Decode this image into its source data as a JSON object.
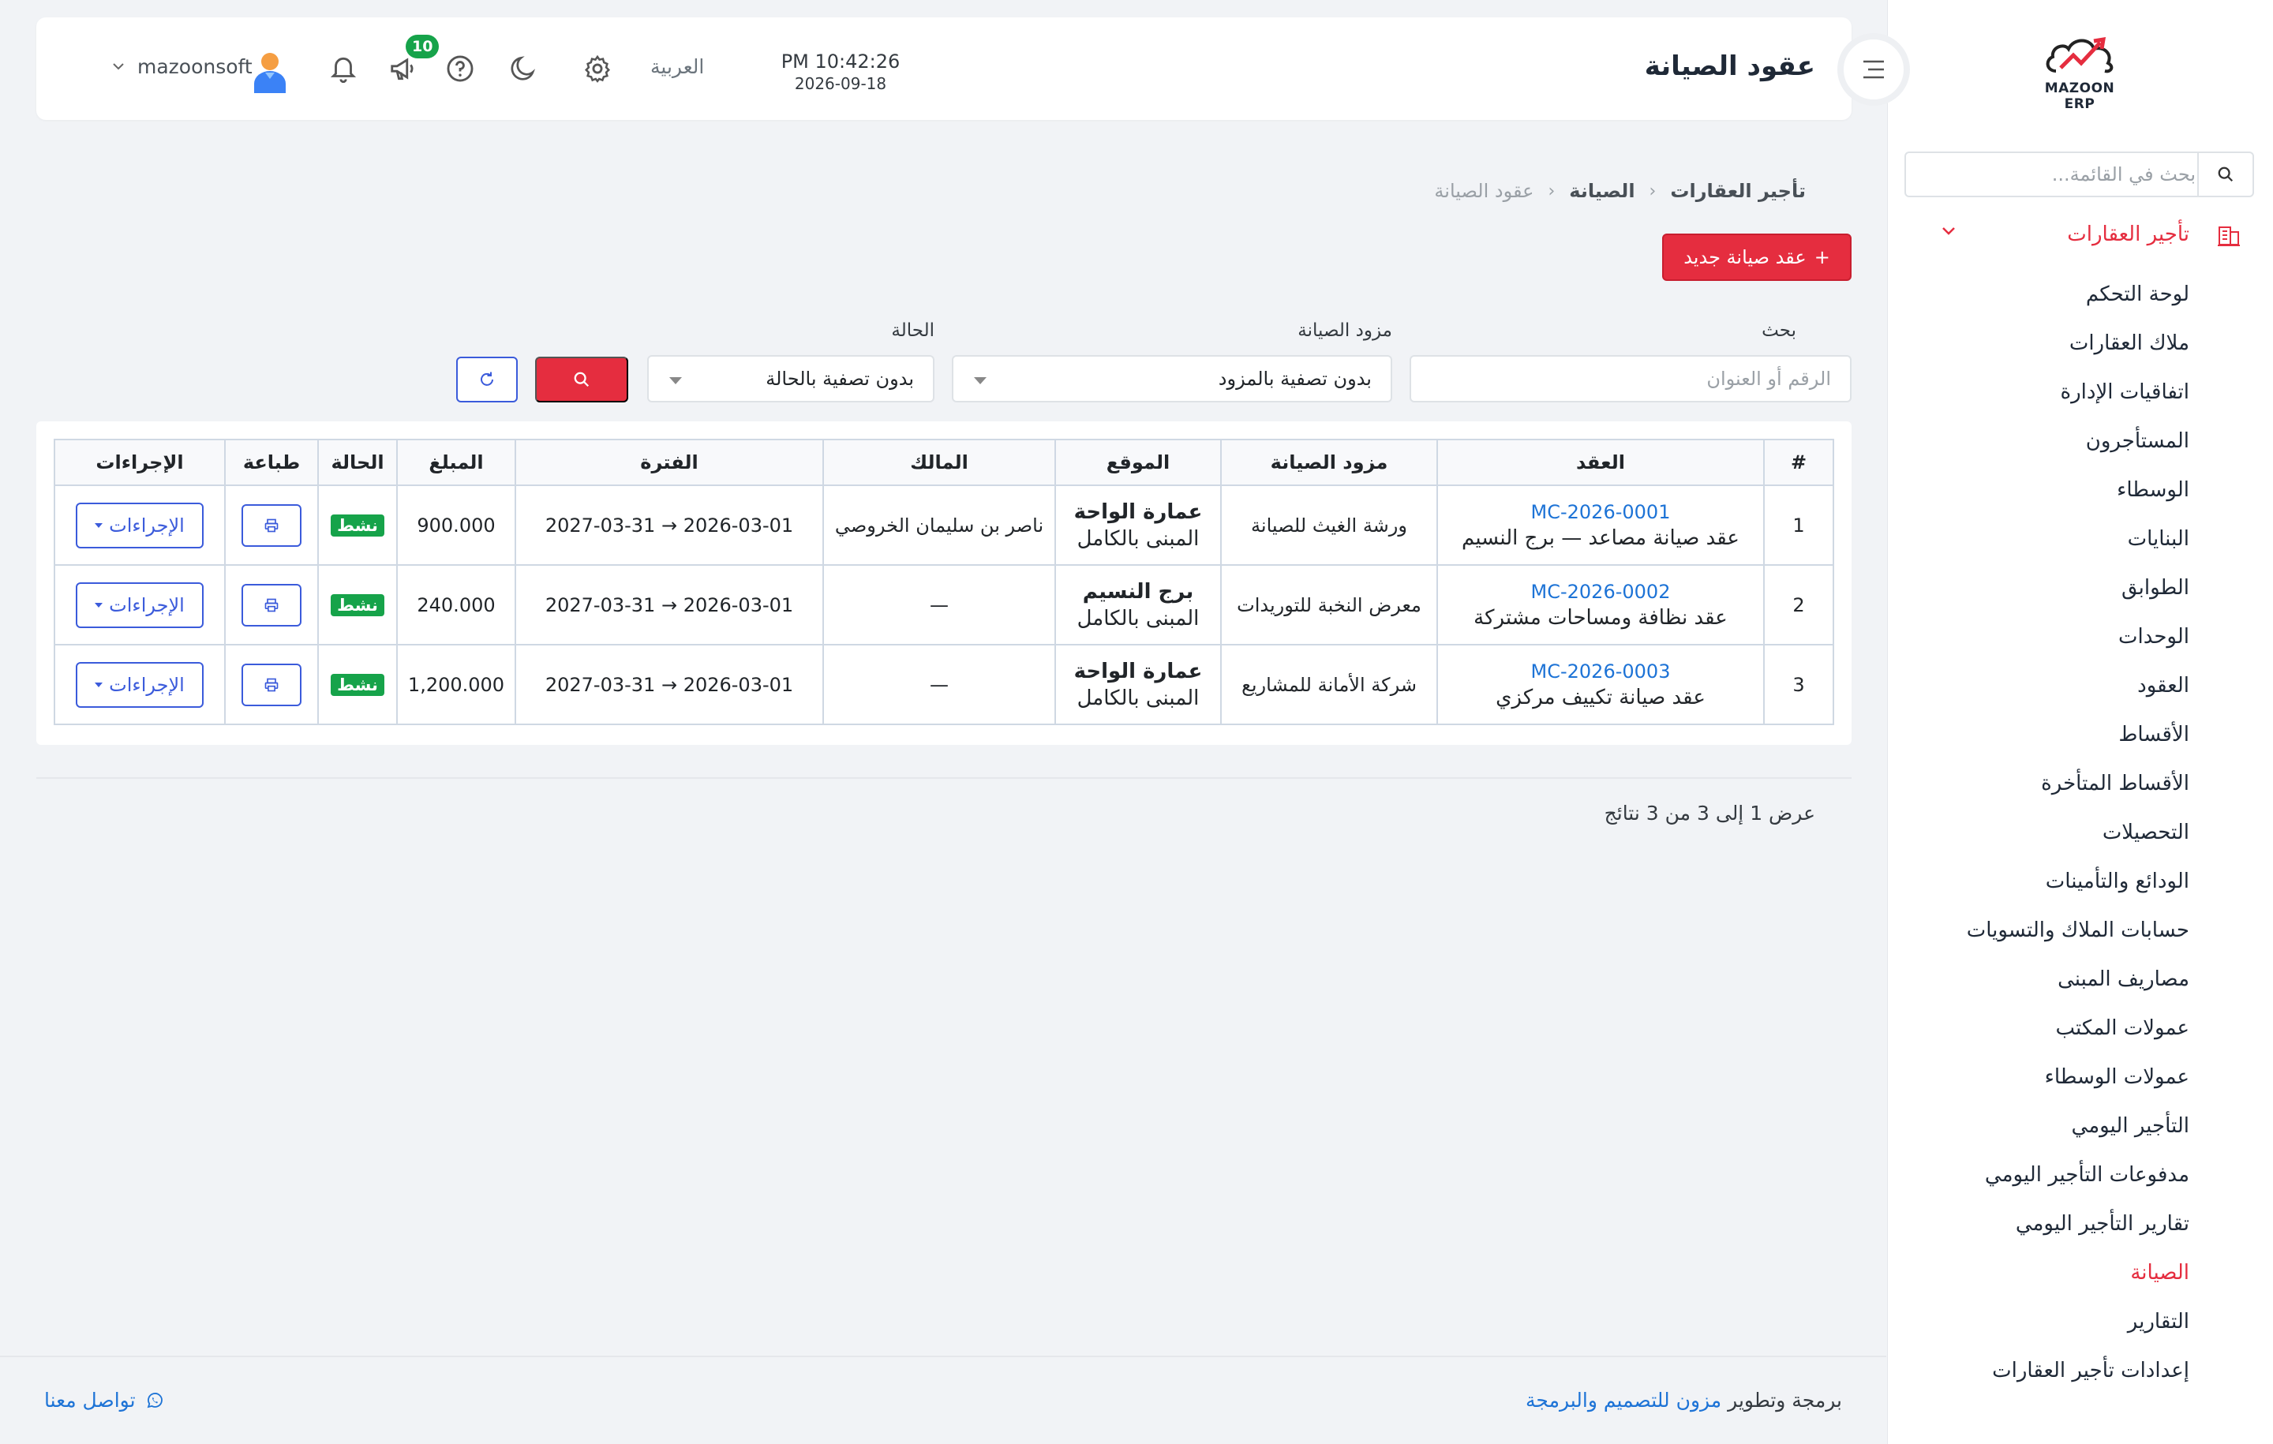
{
  "app": {
    "brand": "MAZOON ERP"
  },
  "sidebar": {
    "search_placeholder": "بحث في القائمة...",
    "parent": {
      "label": "تأجير العقارات",
      "icon": "building-icon"
    },
    "items": [
      {
        "label": "لوحة التحكم"
      },
      {
        "label": "ملاك العقارات"
      },
      {
        "label": "اتفاقيات الإدارة"
      },
      {
        "label": "المستأجرون"
      },
      {
        "label": "الوسطاء"
      },
      {
        "label": "البنايات"
      },
      {
        "label": "الطوابق"
      },
      {
        "label": "الوحدات"
      },
      {
        "label": "العقود"
      },
      {
        "label": "الأقساط"
      },
      {
        "label": "الأقساط المتأخرة"
      },
      {
        "label": "التحصيلات"
      },
      {
        "label": "الودائع والتأمينات"
      },
      {
        "label": "حسابات الملاك والتسويات"
      },
      {
        "label": "مصاريف المبنى"
      },
      {
        "label": "عمولات المكتب"
      },
      {
        "label": "عمولات الوسطاء"
      },
      {
        "label": "التأجير اليومي"
      },
      {
        "label": "مدفوعات التأجير اليومي"
      },
      {
        "label": "تقارير التأجير اليومي"
      },
      {
        "label": "الصيانة",
        "active": true
      },
      {
        "label": "التقارير"
      },
      {
        "label": "إعدادات تأجير العقارات"
      }
    ]
  },
  "header": {
    "title": "عقود الصيانة",
    "time": "PM 10:42:26",
    "date": "2026-09-18",
    "language": "العربية",
    "notifications_badge": "10",
    "username": "mazoonsoft"
  },
  "breadcrumb": [
    "تأجير العقارات",
    "الصيانة",
    "عقود الصيانة"
  ],
  "new_button_label": "عقد صيانة جديد",
  "filters": {
    "search_label": "بحث",
    "search_placeholder": "الرقم أو العنوان",
    "provider_label": "مزود الصيانة",
    "provider_value": "بدون تصفية بالمزود",
    "status_label": "الحالة",
    "status_value": "بدون تصفية بالحالة"
  },
  "table": {
    "headers": [
      "#",
      "العقد",
      "مزود الصيانة",
      "الموقع",
      "المالك",
      "الفترة",
      "المبلغ",
      "الحالة",
      "طباعة",
      "الإجراءات"
    ],
    "rows": [
      {
        "num": "1",
        "code": "MC-2026-0001",
        "title": "عقد صيانة مصاعد — برج النسيم",
        "provider": "ورشة الغيث للصيانة",
        "location": "عمارة الواحة",
        "location_sub": "المبنى بالكامل",
        "owner": "ناصر بن سليمان الخروصي",
        "period": "2026-03-01 → 2027-03-31",
        "amount": "900.000",
        "status": "نشط",
        "actions": "الإجراءات"
      },
      {
        "num": "2",
        "code": "MC-2026-0002",
        "title": "عقد نظافة ومساحات مشتركة",
        "provider": "معرض النخبة للتوريدات",
        "location": "برج النسيم",
        "location_sub": "المبنى بالكامل",
        "owner": "—",
        "period": "2026-03-01 → 2027-03-31",
        "amount": "240.000",
        "status": "نشط",
        "actions": "الإجراءات"
      },
      {
        "num": "3",
        "code": "MC-2026-0003",
        "title": "عقد صيانة تكييف مركزي",
        "provider": "شركة الأمانة للمشاريع",
        "location": "عمارة الواحة",
        "location_sub": "المبنى بالكامل",
        "owner": "—",
        "period": "2026-03-01 → 2027-03-31",
        "amount": "1,200.000",
        "status": "نشط",
        "actions": "الإجراءات"
      }
    ]
  },
  "results_text": "عرض 1 إلى 3 من 3 نتائج",
  "footer": {
    "credit_prefix": "برمجة وتطوير",
    "credit_link": "مزون للتصميم والبرمجة",
    "contact": "تواصل معنا"
  },
  "colors": {
    "accent": "#e52d3f",
    "link": "#1d73d6",
    "primary_outline": "#3b5bdb",
    "success": "#16a34a"
  }
}
